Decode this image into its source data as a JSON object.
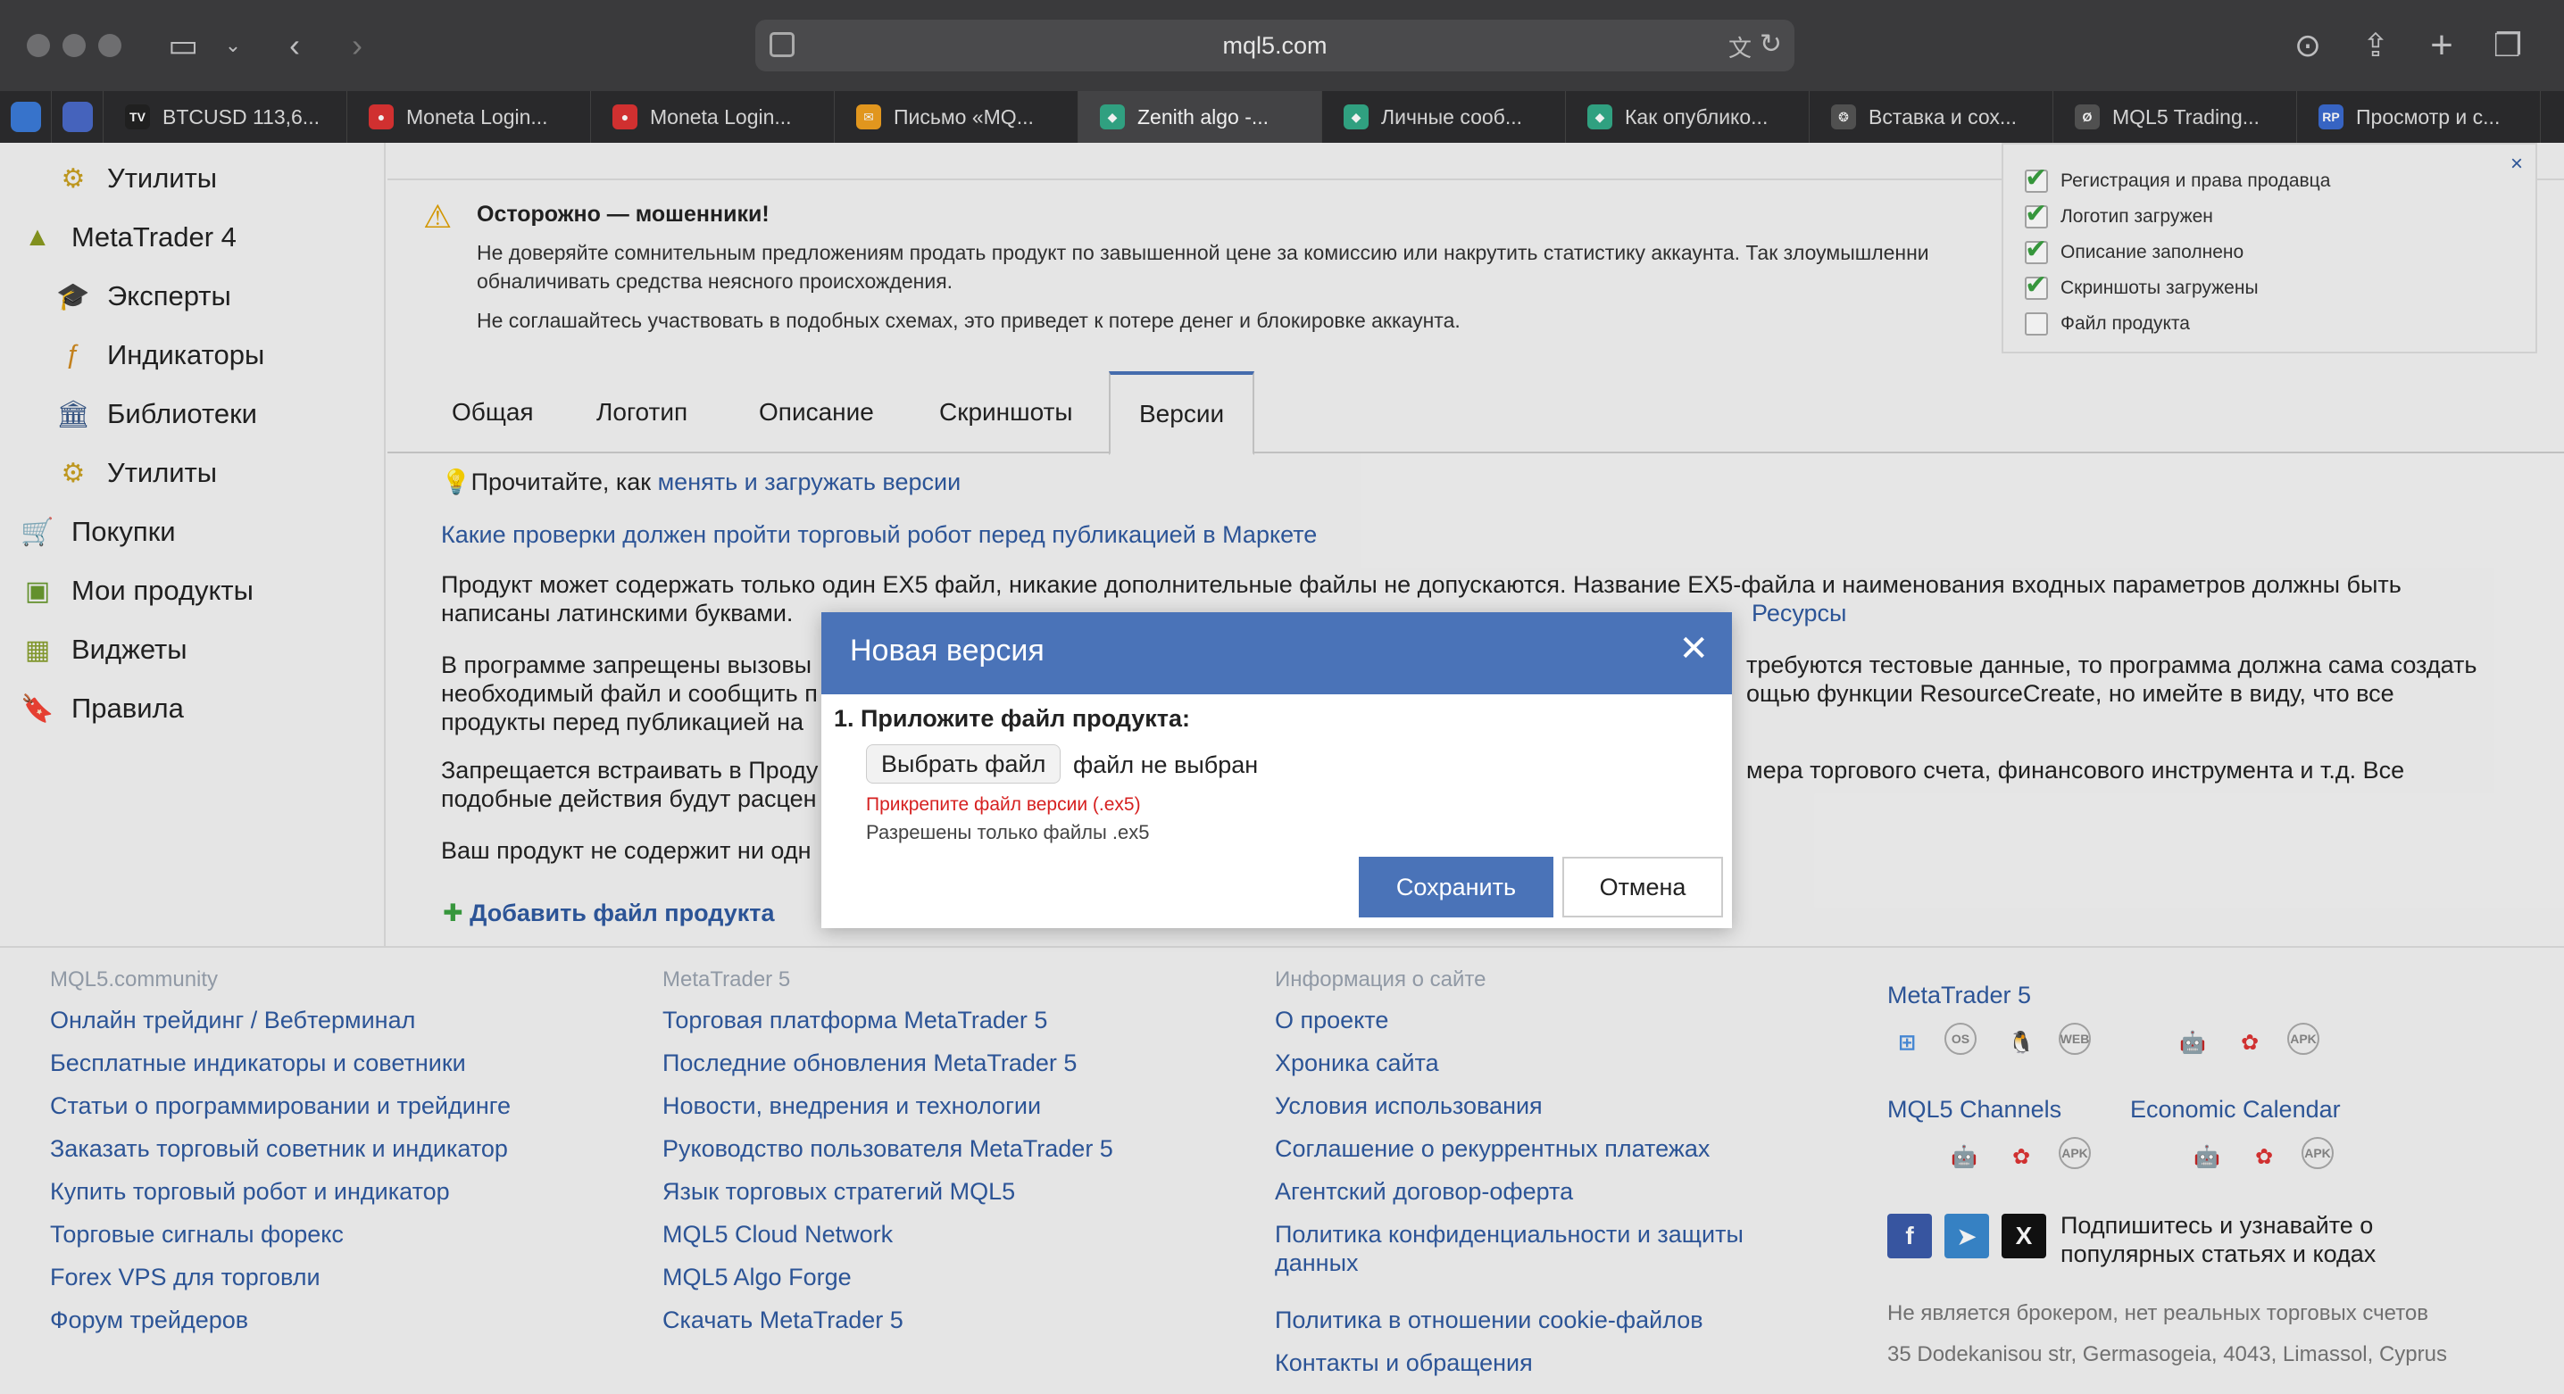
{
  "browser": {
    "url": "mql5.com",
    "tabs": [
      {
        "label": "BTCUSD 113,6...",
        "fav_color": "#222",
        "fav_glyph": "TV"
      },
      {
        "label": "Moneta Login...",
        "fav_color": "#d33",
        "fav_glyph": "●"
      },
      {
        "label": "Moneta Login...",
        "fav_color": "#d33",
        "fav_glyph": "●"
      },
      {
        "label": "Письмо «MQ...",
        "fav_color": "#f0a020",
        "fav_glyph": "✉"
      },
      {
        "label": "Zenith algo -...",
        "fav_color": "#3a8",
        "fav_glyph": "◆"
      },
      {
        "label": "Личные сооб...",
        "fav_color": "#3a8",
        "fav_glyph": "◆"
      },
      {
        "label": "Как опублико...",
        "fav_color": "#3a8",
        "fav_glyph": "◆"
      },
      {
        "label": "Вставка и сох...",
        "fav_color": "#555",
        "fav_glyph": "❂"
      },
      {
        "label": "MQL5 Trading...",
        "fav_color": "#555",
        "fav_glyph": "Ø"
      },
      {
        "label": "Просмотр и с...",
        "fav_color": "#3b6bd0",
        "fav_glyph": "RP"
      }
    ]
  },
  "sidebar": {
    "items": [
      {
        "label": "Утилиты",
        "icon": "⚙"
      },
      {
        "label": "MetaTrader 4",
        "icon": "▲"
      },
      {
        "label": "Эксперты",
        "icon": "🎓"
      },
      {
        "label": "Индикаторы",
        "icon": "ƒ"
      },
      {
        "label": "Библиотеки",
        "icon": "🏛"
      },
      {
        "label": "Утилиты",
        "icon": "⚙"
      },
      {
        "label": "Покупки",
        "icon": "🛒"
      },
      {
        "label": "Мои продукты",
        "icon": "▣"
      },
      {
        "label": "Виджеты",
        "icon": "▦"
      },
      {
        "label": "Правила",
        "icon": "🔖"
      }
    ]
  },
  "warning": {
    "title": "Осторожно — мошенники!",
    "line1": "Не доверяйте сомнительным предложениям продать продукт по завышенной цене за комиссию или накрутить статистику аккаунта. Так злоумышленни",
    "line2": "обналичивать средства неясного происхождения.",
    "line3": "Не соглашайтесь участвовать в подобных схемах, это приведет к потере денег и блокировке аккаунта."
  },
  "product_tabs": [
    "Общая",
    "Логотип",
    "Описание",
    "Скриншоты",
    "Версии"
  ],
  "checklist": {
    "items": [
      {
        "label": "Регистрация и права продавца",
        "checked": true
      },
      {
        "label": "Логотип загружен",
        "checked": true
      },
      {
        "label": "Описание заполнено",
        "checked": true
      },
      {
        "label": "Скриншоты загружены",
        "checked": true
      },
      {
        "label": "Файл продукта",
        "checked": false
      }
    ],
    "close": "×"
  },
  "versions": {
    "read_prefix": "Прочитайте, как ",
    "read_link": "менять и загружать версии",
    "checks_link": "Какие проверки должен пройти торговый робот перед публикацией в Маркете",
    "p1_line1": "Продукт может содержать только один EX5 файл, никакие дополнительные файлы не допускаются. Название EX5-файла и наименования входных параметров должны быть",
    "p1_line2": "написаны латинскими буквами.",
    "p1_link": "Ресурсы",
    "p2_line1": "В программе запрещены вызовы",
    "p2_line1_right": "требуются тестовые данные, то программа должна сама создать",
    "p2_line2": "необходимый файл и сообщить п",
    "p2_line2_right": "ощью функции ResourceCreate, но имейте в виду, что все",
    "p2_line3": "продукты перед публикацией на",
    "p3_line1": "Запрещается встраивать в Проду",
    "p3_line1_right": "мера торгового счета, финансового инструмента и т.д. Все",
    "p3_line2": "подобные действия будут расцен",
    "p4": "Ваш продукт не содержит ни одн",
    "add_file": "Добавить файл продукта"
  },
  "modal": {
    "title": "Новая версия",
    "close": "✕",
    "step": "1. Приложите файл продукта:",
    "file_button": "Выбрать файл",
    "file_none": "файл не выбран",
    "error": "Прикрепите файл версии (.ex5)",
    "hint": "Разрешены только файлы .ex5",
    "save": "Сохранить",
    "cancel": "Отмена"
  },
  "footer": {
    "col1": {
      "head": "MQL5.community",
      "links": [
        "Онлайн трейдинг / Вебтерминал",
        "Бесплатные индикаторы и советники",
        "Статьи о программировании и трейдинге",
        "Заказать торговый советник и индикатор",
        "Купить торговый робот и индикатор",
        "Торговые сигналы форекс",
        "Forex VPS для торговли",
        "Форум трейдеров"
      ]
    },
    "col2": {
      "head": "MetaTrader 5",
      "links": [
        "Торговая платформа MetaTrader 5",
        "Последние обновления MetaTrader 5",
        "Новости, внедрения и технологии",
        "Руководство пользователя MetaTrader 5",
        "Язык торговых стратегий MQL5",
        "MQL5 Cloud Network",
        "MQL5 Algo Forge",
        "Скачать MetaTrader 5"
      ]
    },
    "col3": {
      "head": "Информация о сайте",
      "links": [
        "О проекте",
        "Хроника сайта",
        "Условия использования",
        "Соглашение о рекуррентных платежах",
        "Агентский договор-оферта",
        "Политика конфиденциальности и защиты",
        "данных",
        "Политика в отношении cookie-файлов",
        "Контакты и обращения"
      ]
    },
    "col4": {
      "mt5": "MetaTrader 5",
      "channels": "MQL5 Channels",
      "calendar": "Economic Calendar",
      "subscribe_line1": "Подпишитесь и узнавайте о",
      "subscribe_line2": "популярных статьях и кодах",
      "disclaimer": "Не является брокером, нет реальных торговых счетов",
      "address": "35 Dodekanisou str, Germasogeia, 4043, Limassol, Cyprus",
      "os_icons": [
        "⊞",
        "OS",
        "🐧",
        "WEB",
        "",
        "🤖",
        "✿",
        "APK"
      ],
      "os_colors": [
        "#4a8fe0",
        "#888",
        "#222",
        "#888",
        "#111",
        "#7ab648",
        "#d33",
        "#888"
      ],
      "small_icons": [
        "",
        "🤖",
        "✿",
        "APK"
      ],
      "small_colors": [
        "#111",
        "#7ab648",
        "#d33",
        "#888"
      ],
      "social": [
        {
          "glyph": "f",
          "color": "#3b5bab"
        },
        {
          "glyph": "➤",
          "color": "#3a8ad0"
        },
        {
          "glyph": "X",
          "color": "#111"
        }
      ]
    }
  }
}
